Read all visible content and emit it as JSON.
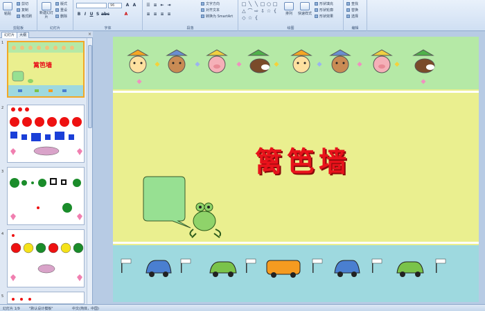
{
  "ribbon": {
    "groups": {
      "clipboard": "剪贴板",
      "slides": "幻灯片",
      "font": "字体",
      "paragraph": "段落",
      "drawing": "绘图",
      "editing": "编辑"
    },
    "paste": "粘贴",
    "cut": "剪切",
    "copy": "复制",
    "format_painter": "格式刷",
    "new_slide": "新建幻灯片",
    "layout": "版式",
    "reset": "重设",
    "delete": "删除",
    "font_size": "96",
    "text_direction": "文字方向",
    "align_text": "对齐文本",
    "convert_smartart": "转换为 SmartArt",
    "arrange": "排列",
    "quick_styles": "快速样式",
    "shape_fill": "形状填充",
    "shape_outline": "形状轮廓",
    "shape_effects": "形状效果",
    "find": "查找",
    "replace": "替换",
    "select": "选择"
  },
  "panel": {
    "tab_slides": "幻灯片",
    "tab_outline": "大纲",
    "close": "×",
    "thumbs": [
      {
        "num": "1",
        "title": "篱笆墙"
      },
      {
        "num": "2",
        "title": ""
      },
      {
        "num": "3",
        "title": ""
      },
      {
        "num": "4",
        "title": ""
      },
      {
        "num": "5",
        "title": ""
      }
    ]
  },
  "slide": {
    "title": "篱笆墙"
  },
  "status": {
    "slide_count": "幻灯片 1/9",
    "theme": "\"默认设计模板\"",
    "language": "中文(简体，中国)"
  },
  "colors": {
    "top_band": "#b5e9a6",
    "bottom_band": "#9ed9df",
    "slide_bg": "#eaef8f",
    "title": "#e8121b",
    "bubble": "#97e092",
    "frog": "#8fd36a"
  }
}
